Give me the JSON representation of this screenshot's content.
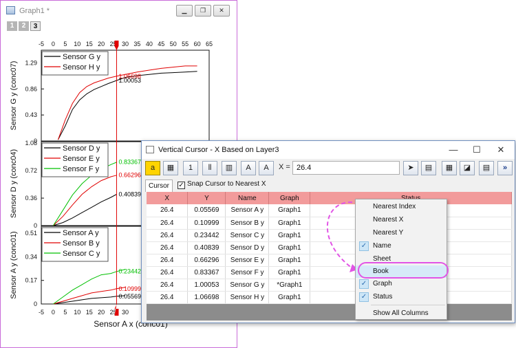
{
  "graph_window": {
    "title": "Graph1 *",
    "layer_tabs": [
      "1",
      "2",
      "3"
    ],
    "active_layer": "3"
  },
  "chart_data": [
    {
      "type": "line",
      "ylabel": "Sensor G y (conc07)",
      "yticks": [
        "1.29",
        "0.86",
        "0.43",
        "0"
      ],
      "ylim": [
        0,
        1.5
      ],
      "xticks": [
        "-5",
        "0",
        "5",
        "10",
        "15",
        "20",
        "25",
        "30",
        "35",
        "40",
        "45",
        "50",
        "55",
        "60",
        "65"
      ],
      "xlim": [
        -5,
        65
      ],
      "legend": "top-left",
      "series": [
        {
          "name": "Sensor G y",
          "color": "#000000",
          "x": [
            2,
            5,
            8,
            11,
            14,
            17,
            20,
            23,
            26.4,
            30,
            35,
            40,
            45,
            50,
            55,
            60
          ],
          "y": [
            0.02,
            0.25,
            0.52,
            0.68,
            0.78,
            0.85,
            0.9,
            0.95,
            1.0,
            1.05,
            1.08,
            1.1,
            1.12,
            1.13,
            1.14,
            1.15
          ]
        },
        {
          "name": "Sensor H y",
          "color": "#e00000",
          "x": [
            2,
            5,
            8,
            11,
            14,
            17,
            20,
            23,
            26.4,
            30,
            35,
            40,
            45,
            50,
            55,
            60
          ],
          "y": [
            0.02,
            0.35,
            0.62,
            0.8,
            0.9,
            0.96,
            1.0,
            1.04,
            1.07,
            1.1,
            1.14,
            1.17,
            1.2,
            1.22,
            1.24,
            1.24
          ]
        }
      ],
      "annotations": [
        "1.06698",
        "1.00053"
      ]
    },
    {
      "type": "line",
      "ylabel": "Sensor D y (conc04)",
      "yticks": [
        "1.08",
        "0.72",
        "0.36",
        "0"
      ],
      "ylim": [
        0,
        1.1
      ],
      "xlim": [
        -5,
        65
      ],
      "legend": "top-left",
      "series": [
        {
          "name": "Sensor D y",
          "color": "#000000",
          "x": [
            0,
            4,
            8,
            12,
            16,
            20,
            24,
            26.4
          ],
          "y": [
            0.0,
            0.04,
            0.1,
            0.17,
            0.24,
            0.31,
            0.37,
            0.41
          ]
        },
        {
          "name": "Sensor E y",
          "color": "#e00000",
          "x": [
            0,
            4,
            8,
            12,
            16,
            20,
            24,
            26.4
          ],
          "y": [
            0.0,
            0.12,
            0.27,
            0.41,
            0.51,
            0.59,
            0.64,
            0.66
          ]
        },
        {
          "name": "Sensor F y",
          "color": "#00c000",
          "x": [
            0,
            4,
            8,
            12,
            16,
            20,
            24,
            26.4
          ],
          "y": [
            0.0,
            0.2,
            0.4,
            0.55,
            0.66,
            0.74,
            0.8,
            0.83
          ]
        }
      ],
      "annotations": [
        "0.83367",
        "0.66296",
        "0.40839"
      ]
    },
    {
      "type": "line",
      "ylabel": "Sensor A y (conc01)",
      "xlabel": "Sensor A x (conc01)",
      "yticks": [
        "0.51",
        "0.34",
        "0.17",
        "0"
      ],
      "ylim": [
        0,
        0.56
      ],
      "xticks": [
        "-5",
        "0",
        "5",
        "10",
        "15",
        "20",
        "25",
        "30"
      ],
      "xlim": [
        -5,
        65
      ],
      "legend": "top-left",
      "series": [
        {
          "name": "Sensor A y",
          "color": "#000000",
          "x": [
            0,
            4,
            8,
            12,
            16,
            20,
            24,
            26.4,
            30
          ],
          "y": [
            0.0,
            0.01,
            0.02,
            0.03,
            0.04,
            0.045,
            0.05,
            0.056,
            0.06
          ]
        },
        {
          "name": "Sensor B y",
          "color": "#e00000",
          "x": [
            0,
            4,
            8,
            12,
            16,
            20,
            24,
            26.4,
            30
          ],
          "y": [
            0.0,
            0.02,
            0.04,
            0.06,
            0.08,
            0.09,
            0.1,
            0.11,
            0.12
          ]
        },
        {
          "name": "Sensor C y",
          "color": "#00c000",
          "x": [
            0,
            4,
            8,
            12,
            16,
            20,
            24,
            26.4,
            30
          ],
          "y": [
            0.0,
            0.05,
            0.1,
            0.14,
            0.18,
            0.21,
            0.22,
            0.234,
            0.25
          ]
        }
      ],
      "annotations": [
        "0.23442",
        "0.10999",
        "0.05569"
      ]
    }
  ],
  "cursor": {
    "x": 26.4
  },
  "dialog": {
    "title": "Vertical Cursor - X Based on Layer3",
    "x_label": "X =",
    "x_value": "26.4",
    "tab": "Cursor",
    "snap_label": "Snap Cursor to Nearest X",
    "columns": [
      "X",
      "Y",
      "Name",
      "Graph",
      "Status"
    ],
    "rows": [
      {
        "x": "26.4",
        "y": "0.05569",
        "name": "Sensor A y",
        "graph": "Graph1"
      },
      {
        "x": "26.4",
        "y": "0.10999",
        "name": "Sensor B y",
        "graph": "Graph1"
      },
      {
        "x": "26.4",
        "y": "0.23442",
        "name": "Sensor C y",
        "graph": "Graph1"
      },
      {
        "x": "26.4",
        "y": "0.40839",
        "name": "Sensor D y",
        "graph": "Graph1"
      },
      {
        "x": "26.4",
        "y": "0.66296",
        "name": "Sensor E y",
        "graph": "Graph1"
      },
      {
        "x": "26.4",
        "y": "0.83367",
        "name": "Sensor F y",
        "graph": "Graph1"
      },
      {
        "x": "26.4",
        "y": "1.00053",
        "name": "Sensor G y",
        "graph": "*Graph1"
      },
      {
        "x": "26.4",
        "y": "1.06698",
        "name": "Sensor H y",
        "graph": "Graph1"
      }
    ],
    "toolbar_icons": [
      "yellow-tool-icon",
      "image-icon",
      "one-icon",
      "columns-icon",
      "rows-icon",
      "font-icon",
      "font-size-icon",
      "run-icon",
      "layout-icon",
      "worksheet-icon",
      "graph-icon",
      "table-icon",
      "chevron-up-icon"
    ]
  },
  "context_menu": {
    "items": [
      {
        "label": "Nearest Index",
        "checked": false
      },
      {
        "label": "Nearest X",
        "checked": false
      },
      {
        "label": "Nearest Y",
        "checked": false
      },
      {
        "label": "Name",
        "checked": true
      },
      {
        "label": "Sheet",
        "checked": false
      },
      {
        "label": "Book",
        "checked": false,
        "highlighted": true
      },
      {
        "label": "Graph",
        "checked": true
      },
      {
        "label": "Status",
        "checked": true
      },
      {
        "label": "Show All Columns",
        "checked": false
      }
    ]
  },
  "colors": {
    "highlight_oval": "#e254e6",
    "header_row": "#f29b9b",
    "cursor_line": "#e00000"
  }
}
